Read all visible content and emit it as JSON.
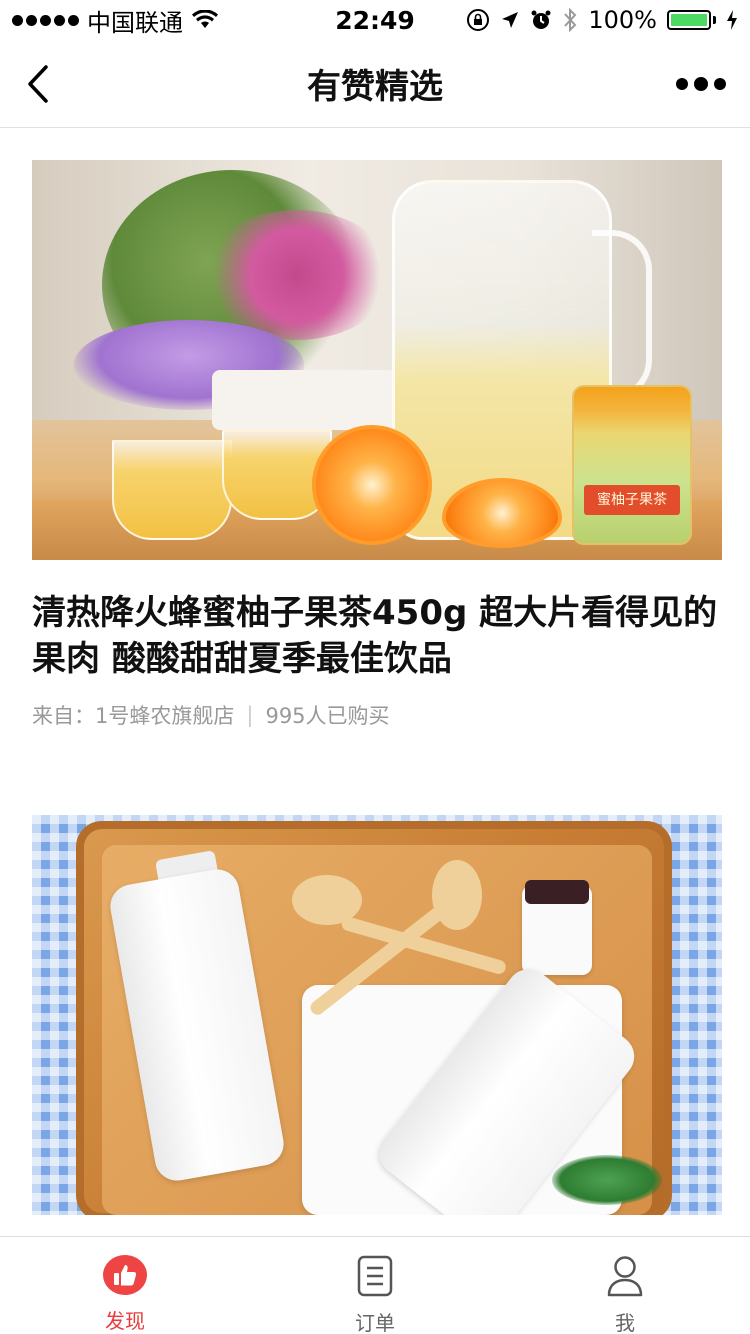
{
  "status_bar": {
    "carrier": "中国联通",
    "time": "22:49",
    "battery_percent": "100%",
    "battery_level": 1.0,
    "signal_bars": 5
  },
  "nav": {
    "title": "有赞精选"
  },
  "feed": [
    {
      "image_desc_icon": "tea-product-photo",
      "jar_label": "蜜柚子果茶",
      "title": "清热降火蜂蜜柚子果茶450g 超大片看得见的果肉 酸酸甜甜夏季最佳饮品",
      "source": "来自：1号蜂农旗舰店",
      "separator": "|",
      "sold": "995人已购买"
    },
    {
      "image_desc_icon": "milk-bath-cream-product-photo"
    }
  ],
  "tab_bar": {
    "tabs": [
      {
        "label": "发现",
        "icon": "thumbs-up-icon",
        "active": true
      },
      {
        "label": "订单",
        "icon": "order-list-icon",
        "active": false
      },
      {
        "label": "我",
        "icon": "user-icon",
        "active": false
      }
    ]
  },
  "colors": {
    "accent": "#e93b3d",
    "battery_green": "#4cd964",
    "meta_text": "#999999"
  }
}
